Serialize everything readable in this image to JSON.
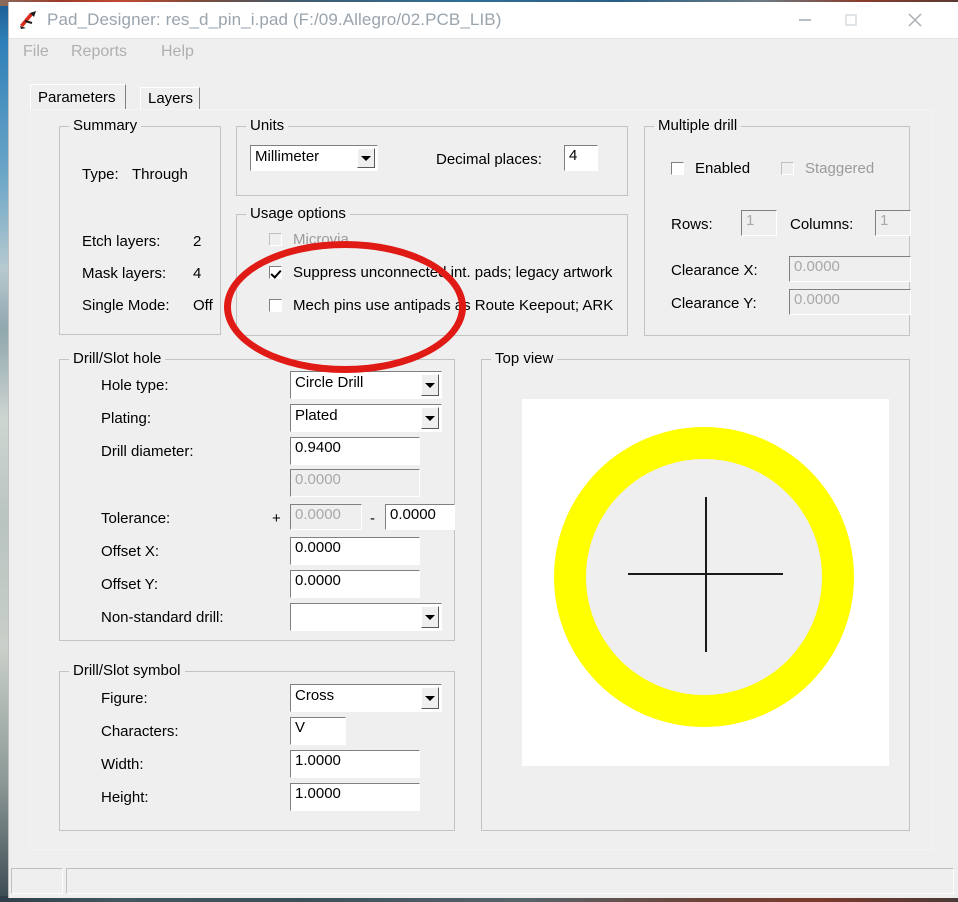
{
  "window": {
    "title": "Pad_Designer: res_d_pin_i.pad (F:/09.Allegro/02.PCB_LIB)",
    "icon": "pad-designer-icon",
    "controls": {
      "minimize": "minimize-icon",
      "maximize": "maximize-icon",
      "close": "close-icon"
    }
  },
  "menubar": {
    "items": [
      {
        "label": "File"
      },
      {
        "label": "Reports"
      },
      {
        "label": "Help"
      }
    ]
  },
  "tabs": [
    {
      "label": "Parameters",
      "selected": true
    },
    {
      "label": "Layers",
      "selected": false
    }
  ],
  "summary": {
    "caption": "Summary",
    "rows": [
      {
        "label": "Type:",
        "value": "Through"
      },
      {
        "label": "Etch layers:",
        "value": "2"
      },
      {
        "label": "Mask layers:",
        "value": "4"
      },
      {
        "label": "Single Mode:",
        "value": "Off"
      }
    ]
  },
  "units": {
    "caption": "Units",
    "unit_value": "Millimeter",
    "decimal_places_label": "Decimal places:",
    "decimal_places_value": "4"
  },
  "usage_options": {
    "caption": "Usage options",
    "items": [
      {
        "label": "Microvia",
        "checked": false,
        "disabled": true
      },
      {
        "label": "Suppress unconnected int. pads; legacy artwork",
        "checked": true,
        "disabled": false
      },
      {
        "label": "Mech pins use antipads as Route Keepout; ARK",
        "checked": false,
        "disabled": false
      }
    ]
  },
  "multiple_drill": {
    "caption": "Multiple drill",
    "enabled_label": "Enabled",
    "enabled_checked": false,
    "staggered_label": "Staggered",
    "staggered_checked": false,
    "staggered_disabled": true,
    "rows_label": "Rows:",
    "rows_value": "1",
    "columns_label": "Columns:",
    "columns_value": "1",
    "clearance_x_label": "Clearance X:",
    "clearance_x_value": "0.0000",
    "clearance_y_label": "Clearance Y:",
    "clearance_y_value": "0.0000"
  },
  "drill_slot_hole": {
    "caption": "Drill/Slot hole",
    "hole_type_label": "Hole type:",
    "hole_type_value": "Circle Drill",
    "plating_label": "Plating:",
    "plating_value": "Plated",
    "drill_diameter_label": "Drill diameter:",
    "drill_diameter_value": "0.9400",
    "secondary_diameter_value": "0.0000",
    "tolerance_label": "Tolerance:",
    "tolerance_plus_sign": "+",
    "tolerance_plus_value": "0.0000",
    "tolerance_minus_sign": "-",
    "tolerance_minus_value": "0.0000",
    "offset_x_label": "Offset X:",
    "offset_x_value": "0.0000",
    "offset_y_label": "Offset Y:",
    "offset_y_value": "0.0000",
    "nonstandard_drill_label": "Non-standard drill:",
    "nonstandard_drill_value": ""
  },
  "drill_slot_symbol": {
    "caption": "Drill/Slot symbol",
    "figure_label": "Figure:",
    "figure_value": "Cross",
    "characters_label": "Characters:",
    "characters_value": "V",
    "width_label": "Width:",
    "width_value": "1.0000",
    "height_label": "Height:",
    "height_value": "1.0000"
  },
  "top_view": {
    "caption": "Top view",
    "pad_color": "#ffff00",
    "hole_color": "#efefef",
    "canvas_color": "#ffffff",
    "crosshair_color": "#1a1a1a"
  },
  "annotation": {
    "shape": "ellipse",
    "color": "#e01b15"
  },
  "statusbar": {
    "left_pane_text": "",
    "right_pane_text": ""
  }
}
